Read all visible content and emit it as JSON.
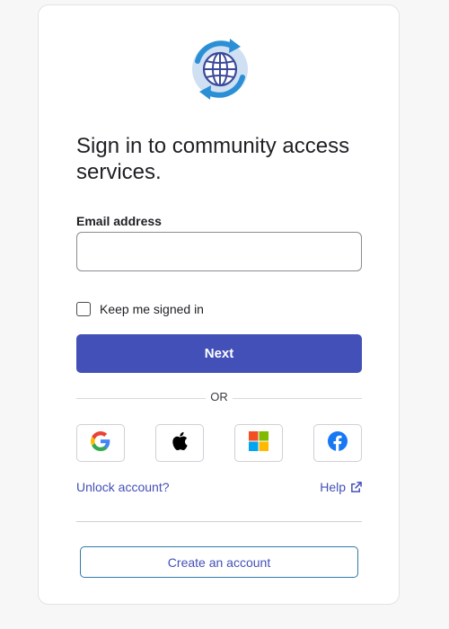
{
  "header": {
    "logo_icon": "globe-refresh-icon",
    "title": "Sign in to community access services."
  },
  "form": {
    "email_label": "Email address",
    "email_value": "",
    "email_placeholder": "",
    "keep_signed_in_label": "Keep me signed in",
    "keep_signed_in_checked": false,
    "next_label": "Next"
  },
  "divider": {
    "or_text": "OR"
  },
  "social": [
    {
      "name": "google",
      "icon": "google-icon"
    },
    {
      "name": "apple",
      "icon": "apple-icon"
    },
    {
      "name": "microsoft",
      "icon": "microsoft-icon"
    },
    {
      "name": "facebook",
      "icon": "facebook-icon"
    }
  ],
  "links": {
    "unlock_label": "Unlock account?",
    "help_label": "Help"
  },
  "footer": {
    "create_account_label": "Create an account"
  },
  "colors": {
    "primary": "#4350b8",
    "link": "#4350b8",
    "create_border": "#2f7aa8",
    "background": "#f7f7f8"
  }
}
